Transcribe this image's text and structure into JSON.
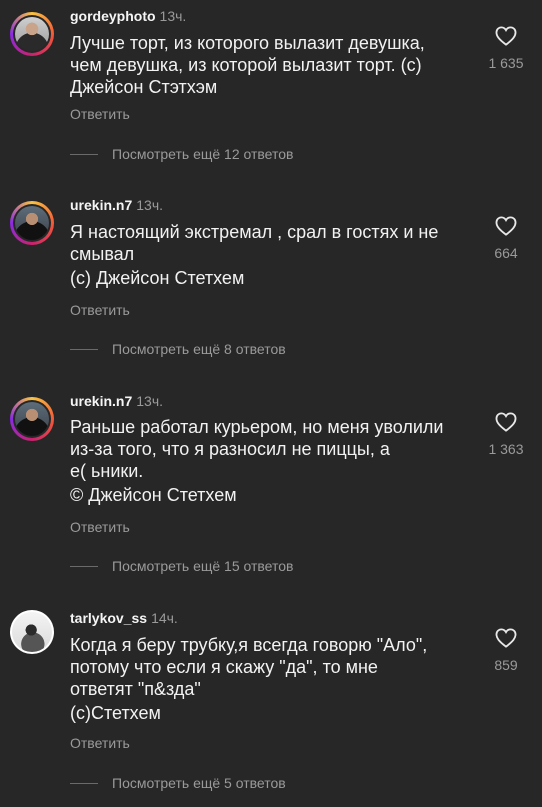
{
  "comments": [
    {
      "username": "gordeyphoto",
      "time": "13ч.",
      "lines": [
        "Лучше торт, из которого вылазит девушка,",
        "чем девушка, из которой вылазит торт. (с)",
        "Джейсон Стэтхэм"
      ],
      "reply_label": "Ответить",
      "more_label": "Посмотреть ещё 12 ответов",
      "likes": "1 635"
    },
    {
      "username": "urekin.n7",
      "time": "13ч.",
      "lines": [
        "Я настоящий экстремал , срал в гостях и не",
        "смывал",
        "(с) Джейсон Стетхем"
      ],
      "reply_label": "Ответить",
      "more_label": "Посмотреть ещё 8 ответов",
      "likes": "664"
    },
    {
      "username": "urekin.n7",
      "time": "13ч.",
      "lines": [
        "Раньше работал курьером, но меня уволили",
        "из-за того, что я разносил не пиццы, а",
        "е(   ьники.",
        "© Джейсон Стетхем"
      ],
      "reply_label": "Ответить",
      "more_label": "Посмотреть ещё 15 ответов",
      "likes": "1 363"
    },
    {
      "username": "tarlykov_ss",
      "time": "14ч.",
      "lines": [
        "Когда я беру трубку,я всегда говорю \"Ало\",",
        "потому что если я скажу \"да\", то мне",
        "ответят \"п&зда\"",
        "(с)Стетхем"
      ],
      "reply_label": "Ответить",
      "more_label": "Посмотреть ещё 5 ответов",
      "likes": "859"
    }
  ],
  "icons": {
    "like": "heart-outline-icon"
  },
  "colors": {
    "background": "#272727",
    "text": "#f2f2f2",
    "muted": "#9a9a9a"
  }
}
